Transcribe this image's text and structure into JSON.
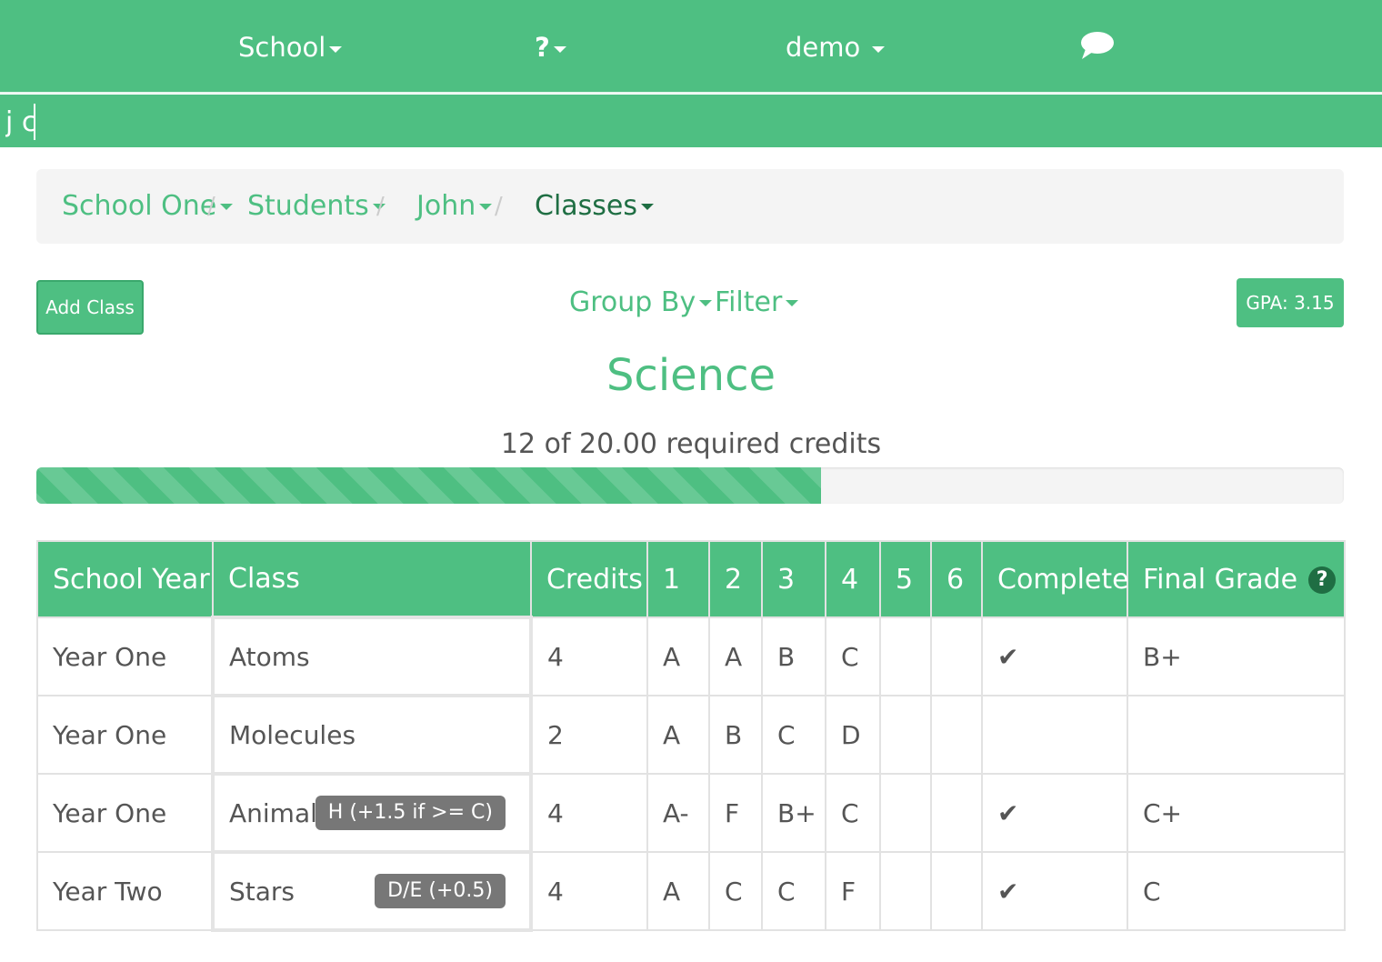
{
  "topnav": {
    "school": "School",
    "help": "?",
    "user": "demo",
    "chat_icon": "speech-bubble-icon"
  },
  "search": {
    "value": "j c"
  },
  "breadcrumb": {
    "items": [
      {
        "label": "School One"
      },
      {
        "label": "Students"
      },
      {
        "label": "John"
      },
      {
        "label": "Classes"
      }
    ]
  },
  "toolbar": {
    "add_class": "Add Class",
    "group_by": "Group By",
    "filter": "Filter",
    "gpa": "GPA: 3.15"
  },
  "subject": {
    "title": "Science",
    "credits_text": "12 of 20.00 required credits",
    "progress_fraction": 0.6
  },
  "table": {
    "headers": {
      "school_year": "School Year",
      "class": "Class",
      "credits": "Credits",
      "q1": "1",
      "q2": "2",
      "q3": "3",
      "q4": "4",
      "q5": "5",
      "q6": "6",
      "complete": "Complete",
      "final_grade": "Final Grade",
      "final_grade_help": "?"
    },
    "rows": [
      {
        "year": "Year One",
        "class": "Atoms",
        "badge": "",
        "credits": "4",
        "g1": "A",
        "g2": "A",
        "g3": "B",
        "g4": "C",
        "g5": "",
        "g6": "",
        "complete": "✔",
        "final": "B+"
      },
      {
        "year": "Year One",
        "class": "Molecules",
        "badge": "",
        "credits": "2",
        "g1": "A",
        "g2": "B",
        "g3": "C",
        "g4": "D",
        "g5": "",
        "g6": "",
        "complete": "",
        "final": ""
      },
      {
        "year": "Year One",
        "class": "Animals",
        "badge": "H (+1.5 if >= C)",
        "credits": "4",
        "g1": "A-",
        "g2": "F",
        "g3": "B+",
        "g4": "C",
        "g5": "",
        "g6": "",
        "complete": "✔",
        "final": "C+"
      },
      {
        "year": "Year Two",
        "class": "Stars",
        "badge": "D/E (+0.5)",
        "credits": "4",
        "g1": "A",
        "g2": "C",
        "g3": "C",
        "g4": "F",
        "g5": "",
        "g6": "",
        "complete": "✔",
        "final": "C"
      }
    ]
  }
}
